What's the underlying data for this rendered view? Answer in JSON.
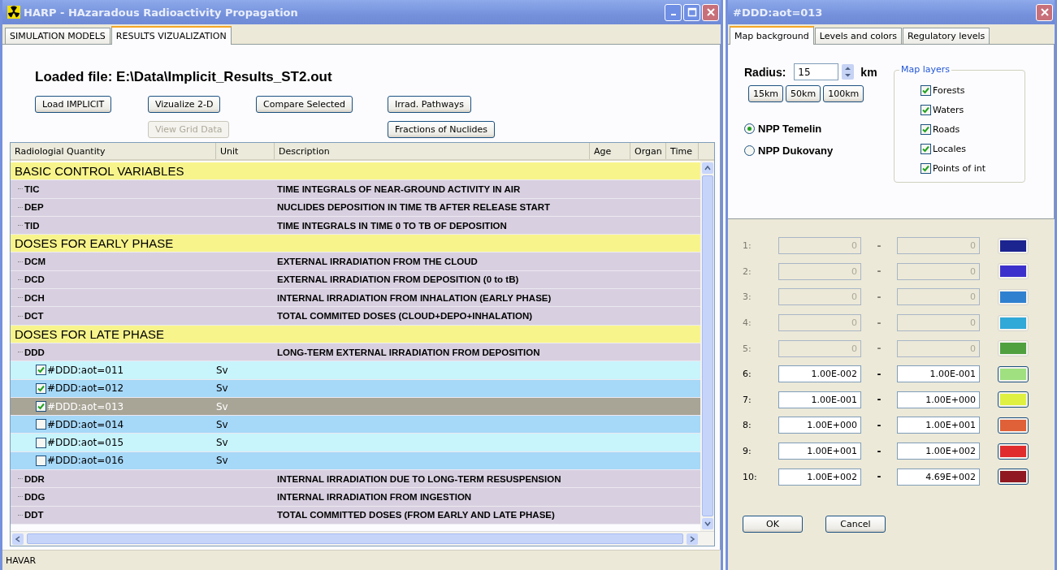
{
  "main_window": {
    "title": "HARP - HAzaradous Radioactivity Propagation",
    "tabs": [
      {
        "label": "SIMULATION MODELS",
        "selected": false
      },
      {
        "label": "RESULTS VIZUALIZATION",
        "selected": true
      }
    ],
    "loaded_file": "Loaded file: E:\\Data\\Implicit_Results_ST2.out",
    "button_rows": [
      [
        {
          "label": "Load IMPLICIT",
          "disabled": false
        },
        {
          "label": "Vizualize 2-D",
          "disabled": false
        },
        {
          "label": "Compare Selected",
          "disabled": false
        },
        {
          "label": "Irrad. Pathways",
          "disabled": false
        }
      ],
      [
        {
          "label": "View Grid Data",
          "disabled": true
        },
        {
          "label": "Fractions of Nuclides",
          "disabled": false
        }
      ]
    ],
    "table": {
      "columns": [
        "Radiologial Quantity",
        "Unit",
        "Description",
        "Age",
        "Organ",
        "Time"
      ],
      "groups": [
        {
          "label": "BASIC CONTROL VARIABLES",
          "items": [
            {
              "code": "TIC",
              "description": "TIME INTEGRALS OF NEAR-GROUND ACTIVITY IN AIR"
            },
            {
              "code": "DEP",
              "description": "NUCLIDES DEPOSITION IN TIME TB AFTER RELEASE START"
            },
            {
              "code": "TID",
              "description": "TIME INTEGRALS IN TIME 0 TO TB OF DEPOSITION"
            }
          ]
        },
        {
          "label": "DOSES FOR EARLY PHASE",
          "items": [
            {
              "code": "DCM",
              "description": "EXTERNAL IRRADIATION FROM THE CLOUD"
            },
            {
              "code": "DCD",
              "description": "EXTERNAL IRRADIATION FROM DEPOSITION (0 to tB)"
            },
            {
              "code": "DCH",
              "description": "INTERNAL IRRADIATION FROM INHALATION (EARLY PHASE)"
            },
            {
              "code": "DCT",
              "description": "TOTAL COMMITED DOSES (CLOUD+DEPO+INHALATION)"
            }
          ]
        },
        {
          "label": "DOSES FOR LATE PHASE",
          "items": [
            {
              "code": "DDD",
              "description": "LONG-TERM EXTERNAL IRRADIATION FROM DEPOSITION",
              "children": [
                {
                  "name": "#DDD:aot=011",
                  "unit": "Sv",
                  "checked": true,
                  "selected": false
                },
                {
                  "name": "#DDD:aot=012",
                  "unit": "Sv",
                  "checked": true,
                  "selected": false
                },
                {
                  "name": "#DDD:aot=013",
                  "unit": "Sv",
                  "checked": true,
                  "selected": true
                },
                {
                  "name": "#DDD:aot=014",
                  "unit": "Sv",
                  "checked": false,
                  "selected": false
                },
                {
                  "name": "#DDD:aot=015",
                  "unit": "Sv",
                  "checked": false,
                  "selected": false
                },
                {
                  "name": "#DDD:aot=016",
                  "unit": "Sv",
                  "checked": false,
                  "selected": false
                }
              ]
            },
            {
              "code": "DDR",
              "description": "INTERNAL IRRADIATION DUE TO LONG-TERM RESUSPENSION"
            },
            {
              "code": "DDG",
              "description": "INTERNAL IRRADIATION FROM INGESTION"
            },
            {
              "code": "DDT",
              "description": "TOTAL COMMITTED DOSES (FROM EARLY AND LATE PHASE)"
            }
          ]
        }
      ]
    },
    "status_bar": "HAVAR"
  },
  "dialog": {
    "title": "#DDD:aot=013",
    "tabs": [
      {
        "label": "Map background",
        "selected": true
      },
      {
        "label": "Levels and colors",
        "selected": false
      },
      {
        "label": "Regulatory levels",
        "selected": false
      }
    ],
    "radius_label": "Radius:",
    "radius_value": "15",
    "radius_unit": "km",
    "radius_presets": [
      "15km",
      "50km",
      "100km"
    ],
    "plants": [
      {
        "label": "NPP Temelin",
        "selected": true
      },
      {
        "label": "NPP Dukovany",
        "selected": false
      }
    ],
    "map_layers": {
      "title": "Map layers",
      "layers": [
        {
          "label": "Forests",
          "checked": true
        },
        {
          "label": "Waters",
          "checked": true
        },
        {
          "label": "Roads",
          "checked": true
        },
        {
          "label": "Locales",
          "checked": true
        },
        {
          "label": "Points of int",
          "checked": true
        }
      ]
    },
    "levels": [
      {
        "label": "1:",
        "from": "0",
        "separator": "-",
        "to": "0",
        "disabled": true,
        "color": "#1c2490"
      },
      {
        "label": "2:",
        "from": "0",
        "separator": "-",
        "to": "0",
        "disabled": true,
        "color": "#3c30cc"
      },
      {
        "label": "3:",
        "from": "0",
        "separator": "-",
        "to": "0",
        "disabled": true,
        "color": "#3080d0"
      },
      {
        "label": "4:",
        "from": "0",
        "separator": "-",
        "to": "0",
        "disabled": true,
        "color": "#30a8d8"
      },
      {
        "label": "5:",
        "from": "0",
        "separator": "-",
        "to": "0",
        "disabled": true,
        "color": "#50a040"
      },
      {
        "label": "6:",
        "from": "1.00E-002",
        "separator": "-",
        "to": "1.00E-001",
        "disabled": false,
        "color": "#a0e080"
      },
      {
        "label": "7:",
        "from": "1.00E-001",
        "separator": "-",
        "to": "1.00E+000",
        "disabled": false,
        "color": "#e0f040"
      },
      {
        "label": "8:",
        "from": "1.00E+000",
        "separator": "-",
        "to": "1.00E+001",
        "disabled": false,
        "color": "#e06038"
      },
      {
        "label": "9:",
        "from": "1.00E+001",
        "separator": "-",
        "to": "1.00E+002",
        "disabled": false,
        "color": "#e02c2c"
      },
      {
        "label": "10:",
        "from": "1.00E+002",
        "separator": "-",
        "to": "4.69E+002",
        "disabled": false,
        "color": "#901820"
      }
    ],
    "buttons": [
      "OK",
      "Cancel"
    ]
  }
}
